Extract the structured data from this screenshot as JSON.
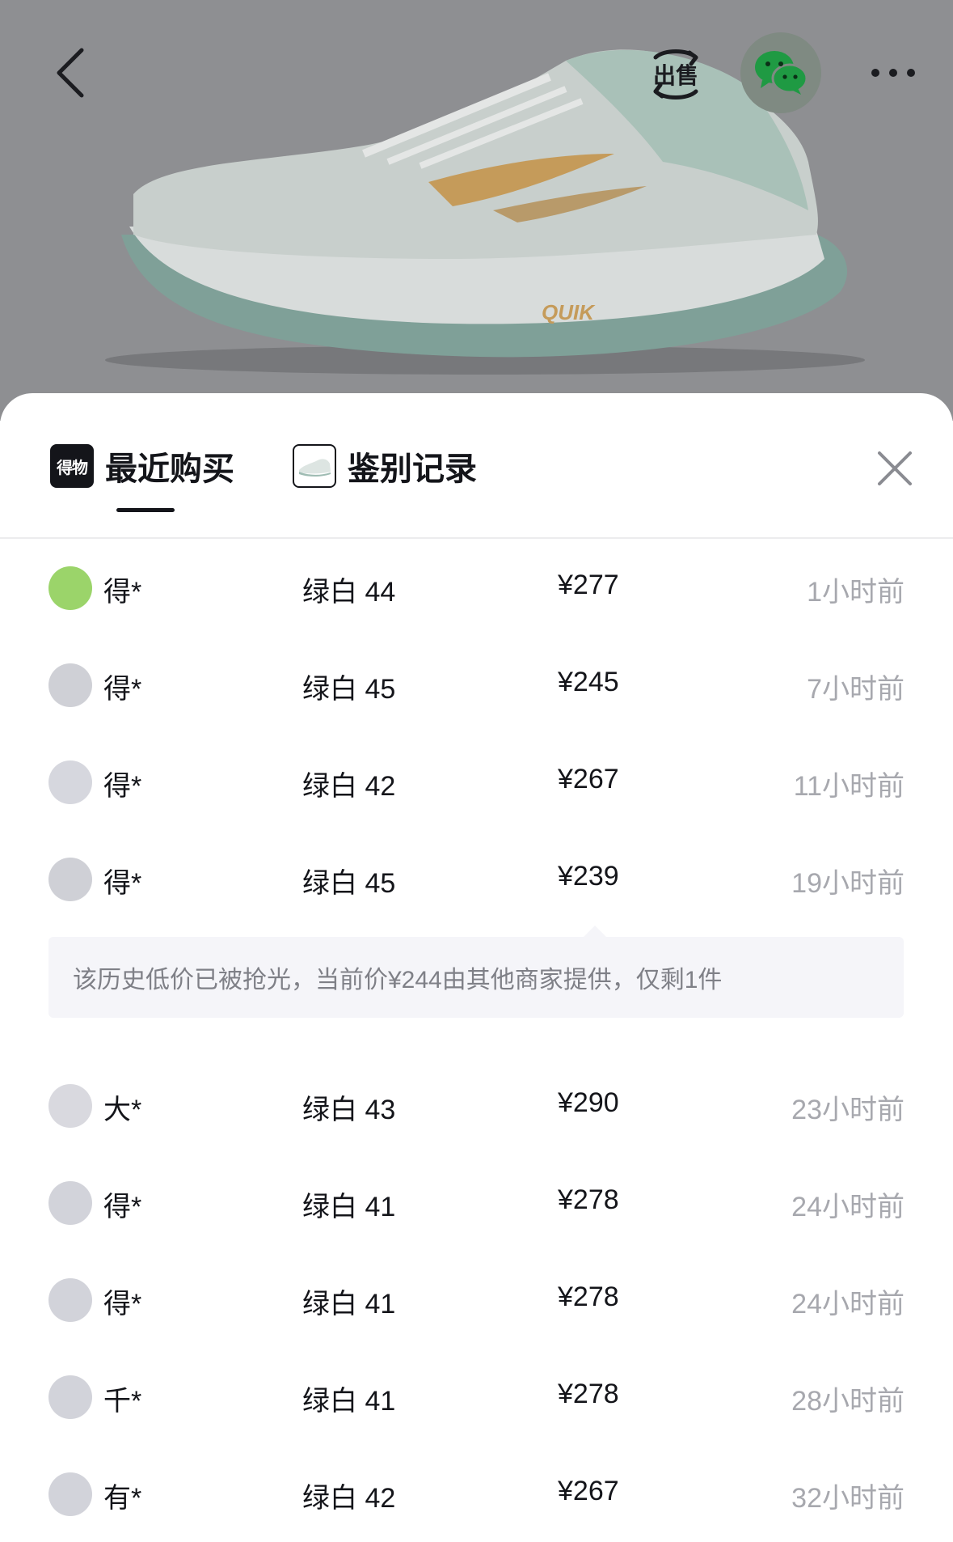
{
  "header": {
    "back_icon": "chevron-left-icon",
    "sell_label": "出售",
    "share_icon": "wechat-icon",
    "more_icon": "more-dots-icon"
  },
  "tabs": [
    {
      "label": "最近购买",
      "icon_text": "得物",
      "active": true
    },
    {
      "label": "鉴别记录",
      "active": false
    }
  ],
  "close_icon": "close-icon",
  "records_before_notice": [
    {
      "buyer": "得*",
      "spec": "绿白 44",
      "price": "¥277",
      "time": "1小时前",
      "avatar_color": "#9bd46a"
    },
    {
      "buyer": "得*",
      "spec": "绿白 45",
      "price": "¥245",
      "time": "7小时前",
      "avatar_color": "#cfd0d6"
    },
    {
      "buyer": "得*",
      "spec": "绿白 42",
      "price": "¥267",
      "time": "11小时前",
      "avatar_color": "#d6d7de"
    },
    {
      "buyer": "得*",
      "spec": "绿白 45",
      "price": "¥239",
      "time": "19小时前",
      "avatar_color": "#cfd0d6"
    }
  ],
  "notice": "该历史低价已被抢光，当前价¥244由其他商家提供，仅剩1件",
  "records_after_notice": [
    {
      "buyer": "大*",
      "spec": "绿白 43",
      "price": "¥290",
      "time": "23小时前",
      "avatar_color": "#d9d9df"
    },
    {
      "buyer": "得*",
      "spec": "绿白 41",
      "price": "¥278",
      "time": "24小时前",
      "avatar_color": "#d2d3da"
    },
    {
      "buyer": "得*",
      "spec": "绿白 41",
      "price": "¥278",
      "time": "24小时前",
      "avatar_color": "#d2d3da"
    },
    {
      "buyer": "千*",
      "spec": "绿白 41",
      "price": "¥278",
      "time": "28小时前",
      "avatar_color": "#d2d3da"
    },
    {
      "buyer": "有*",
      "spec": "绿白 42",
      "price": "¥267",
      "time": "32小时前",
      "avatar_color": "#d2d3da"
    }
  ],
  "colors": {
    "overlay": "#8e8f92",
    "text_primary": "#14151a",
    "text_secondary": "#a7a8ae",
    "notice_bg": "#f5f5f9"
  }
}
